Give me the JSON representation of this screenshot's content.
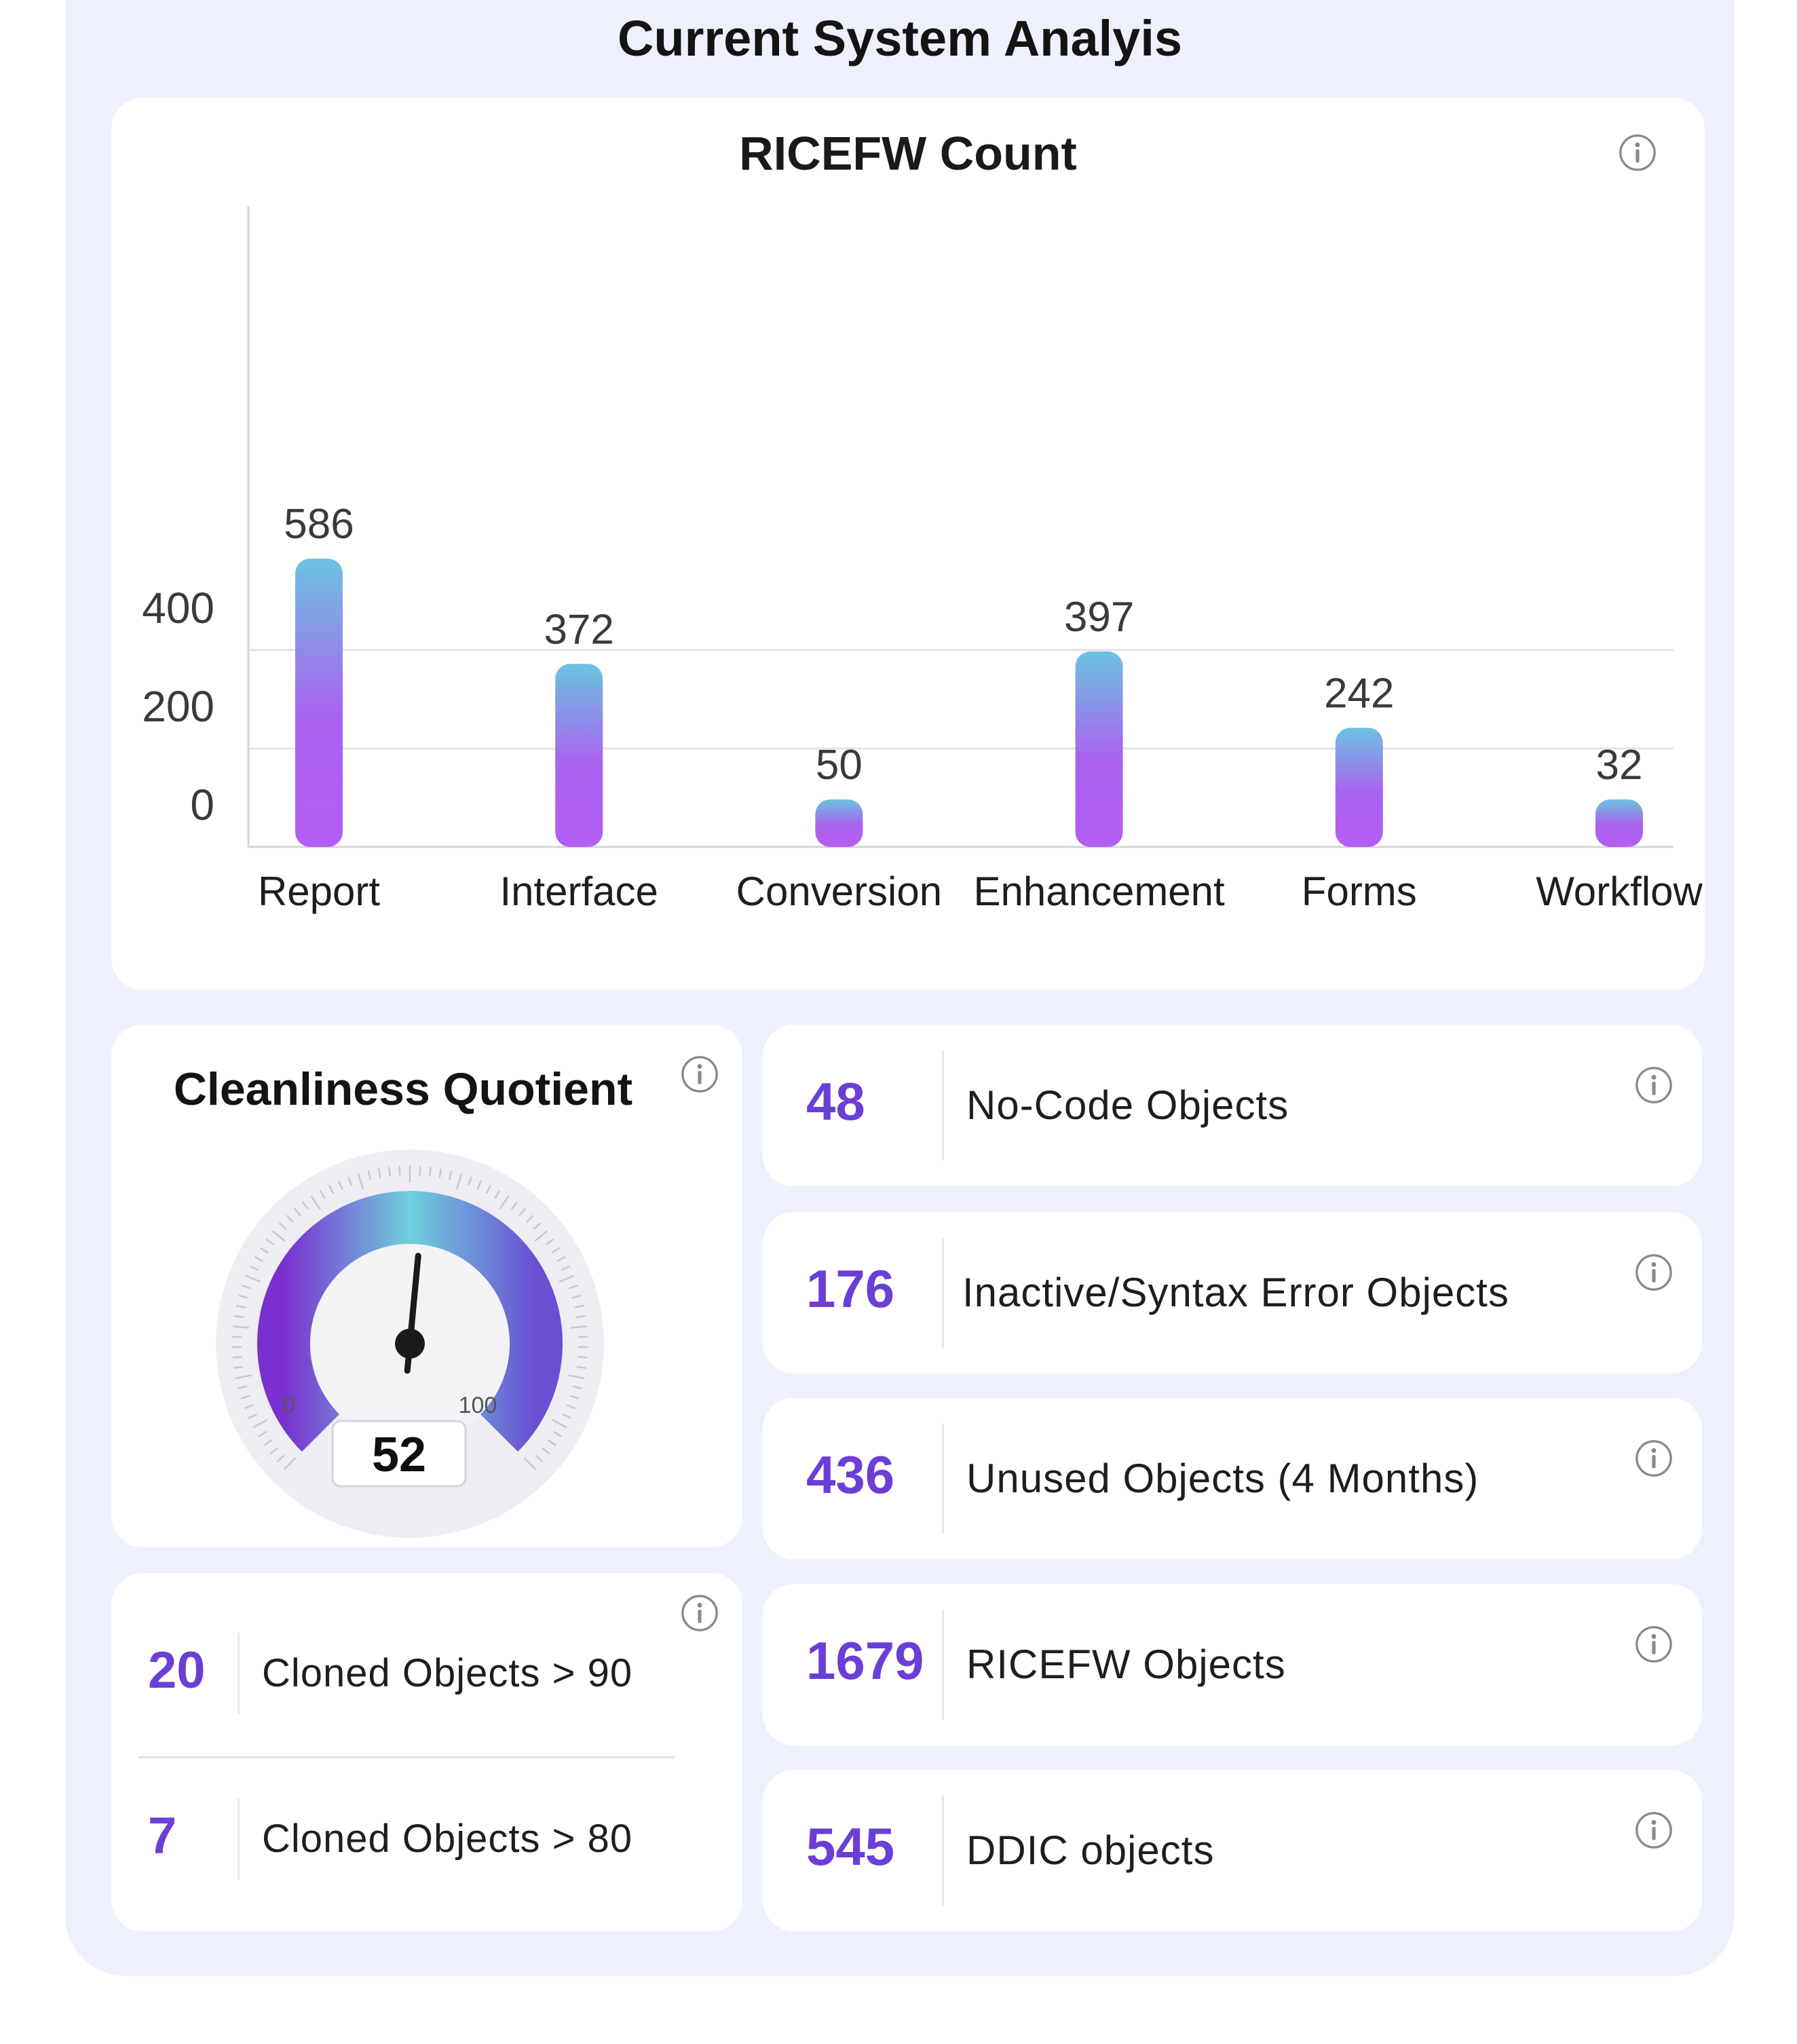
{
  "page": {
    "title": "Current System Analyis"
  },
  "chart_data": {
    "type": "bar",
    "title": "RICEFW Count",
    "categories": [
      "Report",
      "Interface",
      "Conversion",
      "Enhancement",
      "Forms",
      "Workflow"
    ],
    "values": [
      586,
      372,
      50,
      397,
      242,
      32
    ],
    "y_ticks": [
      "0",
      "200",
      "400"
    ],
    "ylim": [
      0,
      650
    ],
    "grid": true,
    "bar_gradient": [
      "#6cc3e0",
      "#a962ee",
      "#b35ef4"
    ]
  },
  "cleanliness": {
    "title": "Cleanliness Quotient",
    "value": "52",
    "level": 52,
    "min_label": "0",
    "max_label": "100",
    "gauge_gradient": [
      "#7a2fd0",
      "#6fd0de",
      "#6a4fd3"
    ]
  },
  "cloned": [
    {
      "value": "20",
      "label": "Cloned Objects > 90"
    },
    {
      "value": "7",
      "label": "Cloned Objects > 80"
    }
  ],
  "stats": [
    {
      "value": "48",
      "label": "No-Code Objects"
    },
    {
      "value": "176",
      "label": "Inactive/Syntax Error Objects"
    },
    {
      "value": "436",
      "label": "Unused Objects (4 Months)"
    },
    {
      "value": "1679",
      "label": "RICEFW Objects"
    },
    {
      "value": "545",
      "label": "DDIC objects"
    }
  ],
  "colors": {
    "accent": "#6b3ed6",
    "frame_bg": "#eef1fd",
    "card_bg": "#ffffff"
  },
  "icons": {
    "info": "info-circle-icon"
  }
}
